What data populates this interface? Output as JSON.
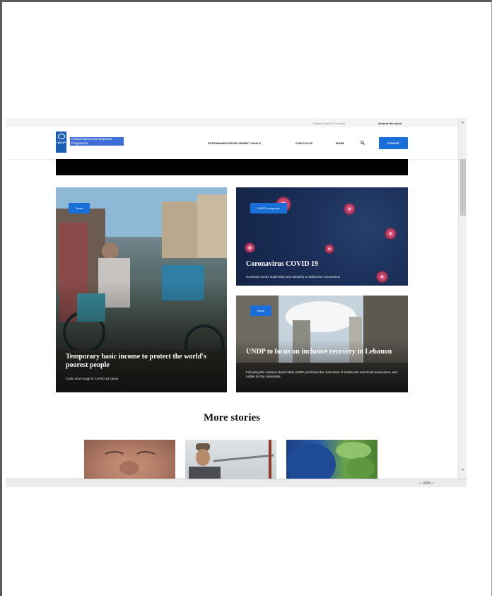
{
  "utility_bar": {
    "languages": "English  Español  Français",
    "around_the_world": "Around the world"
  },
  "header": {
    "logo_letters": "UN DP",
    "logo_text": "United Nations Development Programme",
    "nav": {
      "sdg": "SUSTAINABLE DEVELOPMENT GOALS",
      "focus": "OUR FOCUS",
      "more": "MORE"
    },
    "donate_label": "DONATE"
  },
  "cards": {
    "left": {
      "tag": "News",
      "title": "Temporary basic income to protect the world's poorest people",
      "subtitle": "Could slow surge in COVID-19 cases."
    },
    "top_right": {
      "tag": "UNDP's response",
      "title": "Coronavirus COVID 19",
      "subtitle": "Humanity needs leadership and solidarity to defeat the coronavirus"
    },
    "bottom_right": {
      "tag": "News",
      "title": "UNDP to focus on inclusive recovery in Lebanon",
      "subtitle": "Following the massive Beirut blast UNDP prioritizes the restoration of livelihoods and small businesses, and rubble for the vulnerable."
    }
  },
  "more_stories": {
    "heading": "More stories"
  },
  "statusbar": {
    "zoom": "100%"
  }
}
